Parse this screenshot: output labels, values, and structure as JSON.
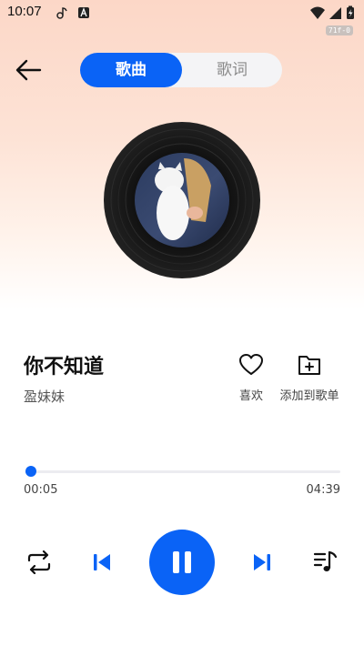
{
  "status_bar": {
    "time": "10:07",
    "badge": "71f-0"
  },
  "tabs": [
    {
      "label": "歌曲",
      "active": true
    },
    {
      "label": "歌词",
      "active": false
    }
  ],
  "song": {
    "title": "你不知道",
    "artist": "盈妹妹"
  },
  "actions": {
    "like_label": "喜欢",
    "add_to_playlist_label": "添加到歌单"
  },
  "progress": {
    "current": "00:05",
    "total": "04:39",
    "fraction": 0.018
  },
  "colors": {
    "accent": "#0a63f6",
    "background_top": "#fcd7c7"
  },
  "controls": {
    "repeat": "repeat-icon",
    "previous": "skip-previous-icon",
    "play_state": "pause-icon",
    "next": "skip-next-icon",
    "queue": "playlist-icon"
  }
}
